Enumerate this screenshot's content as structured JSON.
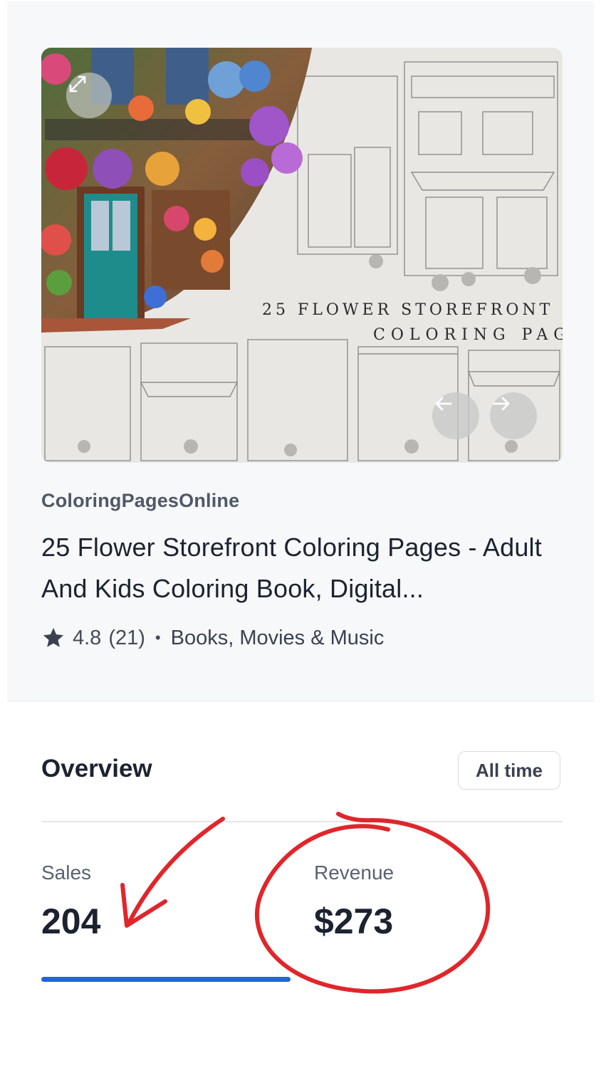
{
  "product": {
    "shop_name": "ColoringPagesOnline",
    "title": "25 Flower Storefront Coloring Pages - Adult And Kids Coloring Book, Digital...",
    "rating": "4.8",
    "review_count": "(21)",
    "separator": "•",
    "category": "Books, Movies & Music",
    "image_text_line1": "25 FLOWER STOREFRONT",
    "image_text_line2": "COLORING PAGES",
    "icons": {
      "expand": "expand-icon",
      "prev": "arrow-left-icon",
      "next": "arrow-right-icon",
      "rating": "star-icon"
    }
  },
  "overview": {
    "heading": "Overview",
    "range_button": "All time",
    "stats": [
      {
        "label": "Sales",
        "value": "204"
      },
      {
        "label": "Revenue",
        "value": "$273"
      }
    ],
    "active_tab": "Sales"
  },
  "colors": {
    "accent": "#2563d9",
    "annotation": "#e0262b",
    "text_primary": "#1c2230",
    "card_bg": "#f7f8fa"
  }
}
